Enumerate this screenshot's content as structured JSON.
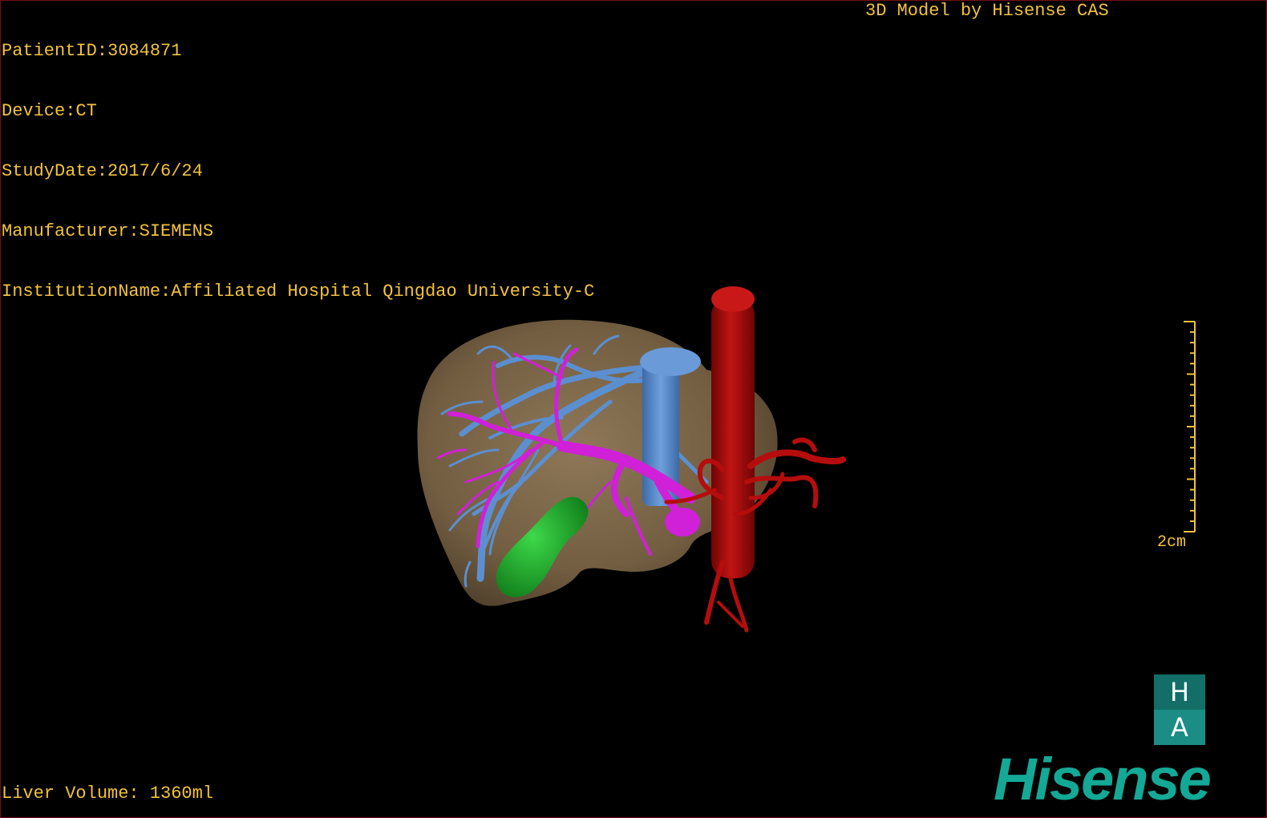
{
  "overlay": {
    "patient_id": "PatientID:3084871",
    "device": "Device:CT",
    "study_date": "StudyDate:2017/6/24",
    "manufacturer": "Manufacturer:SIEMENS",
    "institution": "InstitutionName:Affiliated Hospital Qingdao University-C",
    "credit": "3D Model by Hisense CAS",
    "liver_volume": "Liver Volume: 1360ml"
  },
  "scale_bar": {
    "label": "2cm"
  },
  "logo": {
    "ha_top": "H",
    "ha_bottom": "A",
    "brand": "Hisense"
  },
  "colors": {
    "overlay_text": "#f2c23a",
    "liver": "#8a7253",
    "portal_vein": "#d020d8",
    "hepatic_vein": "#5b8fd0",
    "artery_aorta": "#b50d0d",
    "gallbladder": "#1fae2b",
    "brand": "#14a896"
  },
  "icons": {
    "3d_model": "liver-3d-model",
    "brand_logo": "ha-logo"
  }
}
